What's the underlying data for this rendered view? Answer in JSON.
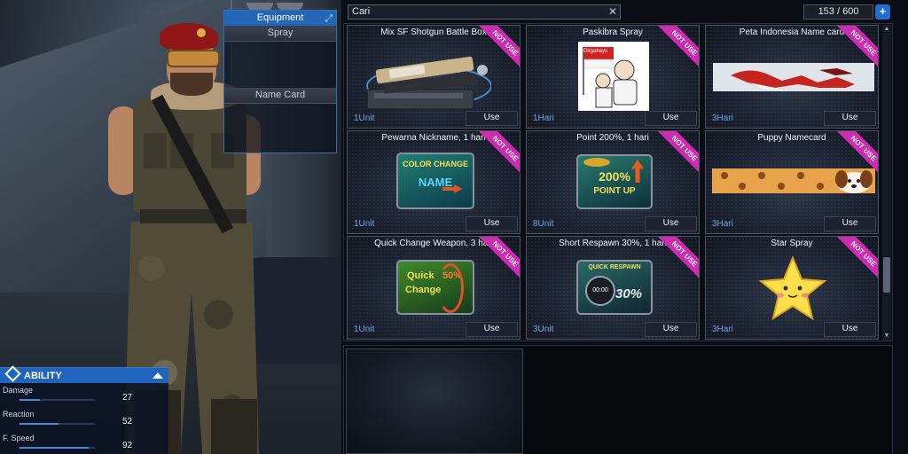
{
  "equipment": {
    "title": "Equipment",
    "slots": [
      "Spray",
      "Name Card"
    ]
  },
  "ability": {
    "title": "ABILITY",
    "stats": [
      {
        "label": "Damage",
        "value": "27",
        "fill": 0.27
      },
      {
        "label": "Reaction",
        "value": "52",
        "fill": 0.52
      },
      {
        "label": "F. Speed",
        "value": "92",
        "fill": 0.92
      }
    ]
  },
  "inventory": {
    "search_value": "Cari",
    "count": "153 / 600",
    "badge": "NOT USE",
    "use_label": "Use",
    "items": [
      {
        "title": "Mix SF Shotgun Battle Box",
        "qty": "1Unit"
      },
      {
        "title": "Paskibra Spray",
        "qty": "1Hari",
        "art_text": "Dirgahayu"
      },
      {
        "title": "Peta Indonesia Name card",
        "qty": "3Hari"
      },
      {
        "title": "Pewarna Nickname, 1 hari",
        "qty": "1Unit",
        "art_text": "COLOR CHANGE",
        "art_sub": "NAME"
      },
      {
        "title": "Point 200%, 1 hari",
        "qty": "8Unit",
        "art_text": "200%",
        "art_sub": "POINT UP"
      },
      {
        "title": "Puppy Namecard",
        "qty": "3Hari"
      },
      {
        "title": "Quick Change Weapon, 3 hari",
        "qty": "1Unit",
        "art_text": "Quick",
        "art_sub": "Change",
        "art_extra": "50%"
      },
      {
        "title": "Short Respawn 30%, 1 hari",
        "qty": "3Unit",
        "art_text": "QUICK RESPAWN",
        "art_sub": "30%",
        "art_extra": "00:00"
      },
      {
        "title": "Star Spray",
        "qty": "3Hari"
      }
    ]
  },
  "colors": {
    "accent_blue": "#1f64bf",
    "badge_magenta": "#cc2bb2",
    "qty_blue": "#6fa4e8"
  }
}
